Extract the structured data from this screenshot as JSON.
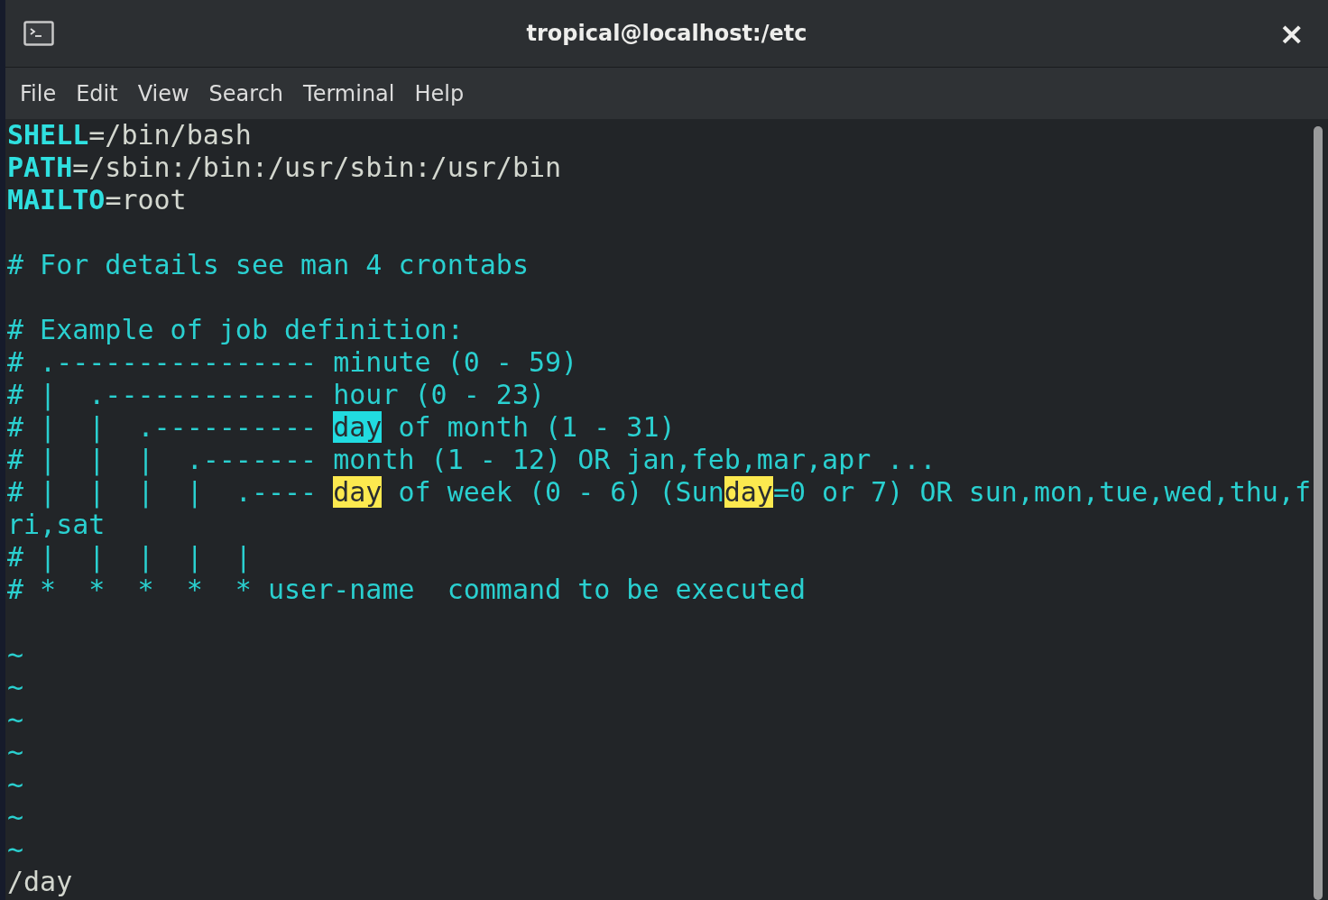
{
  "window": {
    "title": "tropical@localhost:/etc",
    "close": "×"
  },
  "menu": [
    "File",
    "Edit",
    "View",
    "Search",
    "Terminal",
    "Help"
  ],
  "lines": [
    {
      "kind": "text",
      "segments": [
        {
          "text": "SHELL",
          "kind": "variable"
        },
        {
          "text": "=/bin/bash",
          "kind": "value"
        }
      ]
    },
    {
      "kind": "text",
      "segments": [
        {
          "text": "PATH",
          "kind": "variable"
        },
        {
          "text": "=/sbin:/bin:/usr/sbin:/usr/bin",
          "kind": "value"
        }
      ]
    },
    {
      "kind": "text",
      "segments": [
        {
          "text": "MAILTO",
          "kind": "variable"
        },
        {
          "text": "=root",
          "kind": "value"
        }
      ]
    },
    {
      "kind": "blank"
    },
    {
      "kind": "text",
      "segments": [
        {
          "text": "# For details see man 4 crontabs",
          "kind": "comment"
        }
      ]
    },
    {
      "kind": "blank"
    },
    {
      "kind": "text",
      "segments": [
        {
          "text": "# Example of job definition:",
          "kind": "comment"
        }
      ]
    },
    {
      "kind": "text",
      "segments": [
        {
          "text": "# .---------------- minute (0 - 59)",
          "kind": "comment"
        }
      ]
    },
    {
      "kind": "text",
      "segments": [
        {
          "text": "# |  .------------- hour (0 - 23)",
          "kind": "comment"
        }
      ]
    },
    {
      "kind": "text",
      "segments": [
        {
          "text": "# |  |  .---------- ",
          "kind": "comment"
        },
        {
          "text": "day",
          "kind": "current_match"
        },
        {
          "text": " of month (1 - 31)",
          "kind": "comment"
        }
      ]
    },
    {
      "kind": "text",
      "segments": [
        {
          "text": "# |  |  |  .------- month (1 - 12) OR jan,feb,mar,apr ...",
          "kind": "comment"
        }
      ]
    },
    {
      "kind": "text",
      "segments": [
        {
          "text": "# |  |  |  |  .---- ",
          "kind": "comment"
        },
        {
          "text": "day",
          "kind": "match"
        },
        {
          "text": " of week (0 - 6) (Sun",
          "kind": "comment"
        },
        {
          "text": "day",
          "kind": "match"
        },
        {
          "text": "=0 or 7) OR sun,mon,tue,wed,thu,f",
          "kind": "comment"
        }
      ]
    },
    {
      "kind": "text",
      "segments": [
        {
          "text": "ri,sat",
          "kind": "comment"
        }
      ]
    },
    {
      "kind": "text",
      "segments": [
        {
          "text": "# |  |  |  |  |",
          "kind": "comment"
        }
      ]
    },
    {
      "kind": "text",
      "segments": [
        {
          "text": "# *  *  *  *  * user-name  command to be executed",
          "kind": "comment"
        }
      ]
    },
    {
      "kind": "blank"
    },
    {
      "kind": "tilde",
      "text": "~"
    },
    {
      "kind": "tilde",
      "text": "~"
    },
    {
      "kind": "tilde",
      "text": "~"
    },
    {
      "kind": "tilde",
      "text": "~"
    },
    {
      "kind": "tilde",
      "text": "~"
    },
    {
      "kind": "tilde",
      "text": "~"
    },
    {
      "kind": "tilde",
      "text": "~"
    }
  ],
  "command_line": "/day"
}
